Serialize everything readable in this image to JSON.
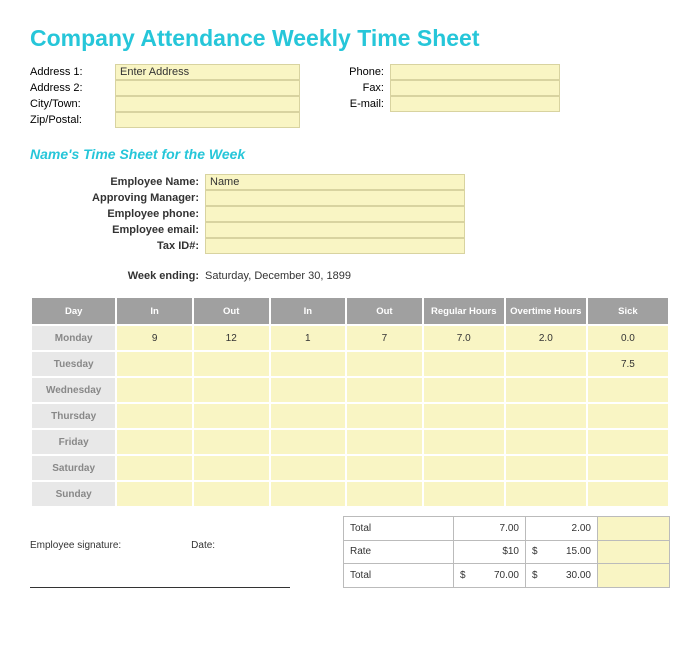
{
  "title": "Company Attendance Weekly Time Sheet",
  "address": {
    "label1": "Address 1:",
    "label2": "Address 2:",
    "label3": "City/Town:",
    "label4": "Zip/Postal:",
    "value1": "Enter Address",
    "value2": "",
    "value3": "",
    "value4": ""
  },
  "contact": {
    "label1": "Phone:",
    "label2": "Fax:",
    "label3": "E-mail:",
    "value1": "",
    "value2": "",
    "value3": ""
  },
  "subtitle": "Name's Time Sheet for the Week",
  "employee": {
    "name_label": "Employee Name:",
    "name": "Name",
    "manager_label": "Approving Manager:",
    "manager": "",
    "phone_label": "Employee phone:",
    "phone": "",
    "email_label": "Employee email:",
    "email": "",
    "tax_label": "Tax ID#:",
    "tax": ""
  },
  "week": {
    "label": "Week ending:",
    "value": "Saturday, December 30, 1899"
  },
  "table": {
    "headers": [
      "Day",
      "In",
      "Out",
      "In",
      "Out",
      "Regular Hours",
      "Overtime Hours",
      "Sick"
    ],
    "rows": [
      {
        "day": "Monday",
        "in1": "9",
        "out1": "12",
        "in2": "1",
        "out2": "7",
        "reg": "7.0",
        "ot": "2.0",
        "sick": "0.0"
      },
      {
        "day": "Tuesday",
        "in1": "",
        "out1": "",
        "in2": "",
        "out2": "",
        "reg": "",
        "ot": "",
        "sick": "7.5"
      },
      {
        "day": "Wednesday",
        "in1": "",
        "out1": "",
        "in2": "",
        "out2": "",
        "reg": "",
        "ot": "",
        "sick": ""
      },
      {
        "day": "Thursday",
        "in1": "",
        "out1": "",
        "in2": "",
        "out2": "",
        "reg": "",
        "ot": "",
        "sick": ""
      },
      {
        "day": "Friday",
        "in1": "",
        "out1": "",
        "in2": "",
        "out2": "",
        "reg": "",
        "ot": "",
        "sick": ""
      },
      {
        "day": "Saturday",
        "in1": "",
        "out1": "",
        "in2": "",
        "out2": "",
        "reg": "",
        "ot": "",
        "sick": ""
      },
      {
        "day": "Sunday",
        "in1": "",
        "out1": "",
        "in2": "",
        "out2": "",
        "reg": "",
        "ot": "",
        "sick": ""
      }
    ]
  },
  "signature": {
    "emp": "Employee signature:",
    "date": "Date:"
  },
  "summary": {
    "total_label": "Total",
    "total_reg": "7.00",
    "total_ot": "2.00",
    "rate_label": "Rate",
    "rate_reg": "$10",
    "rate_ot_prefix": "$",
    "rate_ot": "15.00",
    "grand_label": "Total",
    "grand_reg_prefix": "$",
    "grand_reg": "70.00",
    "grand_ot_prefix": "$",
    "grand_ot": "30.00"
  }
}
